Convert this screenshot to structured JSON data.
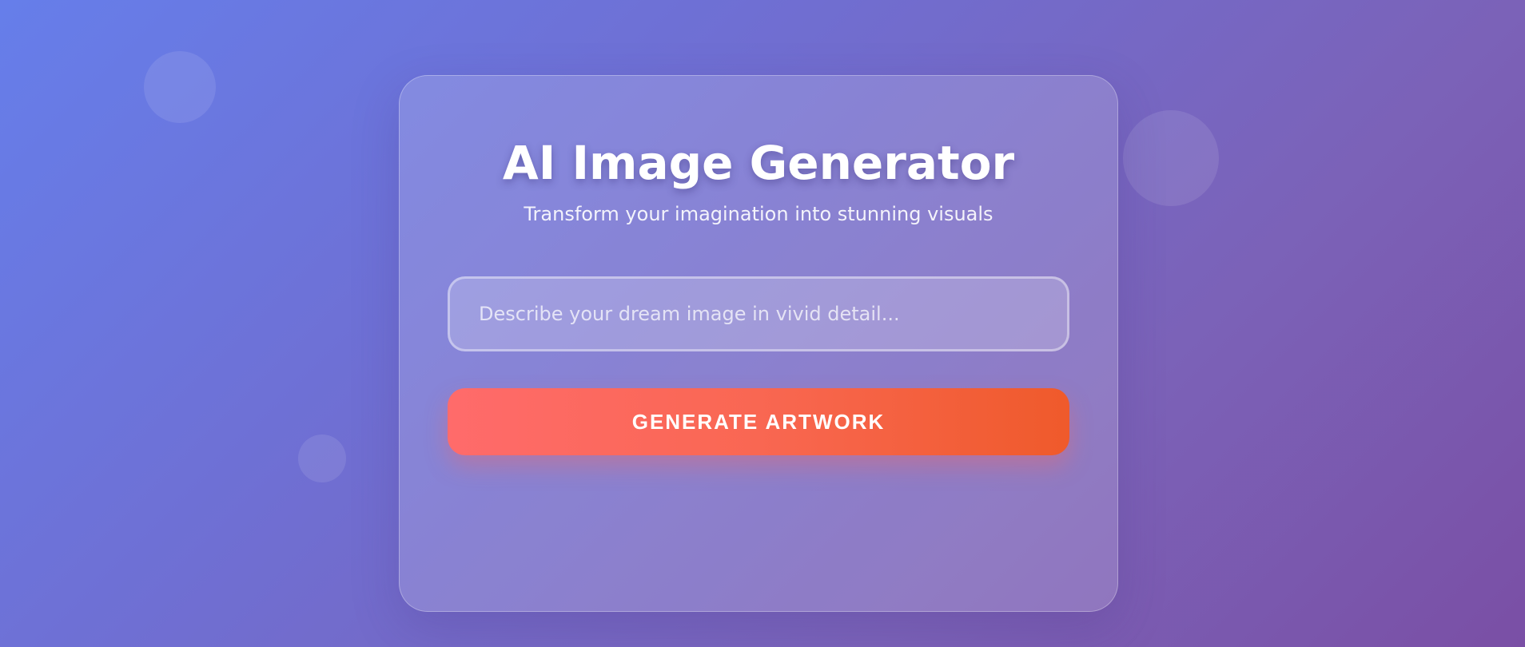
{
  "app": {
    "title": "AI Image Generator",
    "subtitle": "Transform your imagination into stunning visuals"
  },
  "prompt": {
    "placeholder": "Describe your dream image in vivid detail...",
    "value": ""
  },
  "actions": {
    "generate_label": "GENERATE ARTWORK"
  },
  "colors": {
    "background_start": "#667eea",
    "background_end": "#7a4fa5",
    "button_start": "#ff6b6b",
    "button_end": "#ef5a2b"
  }
}
